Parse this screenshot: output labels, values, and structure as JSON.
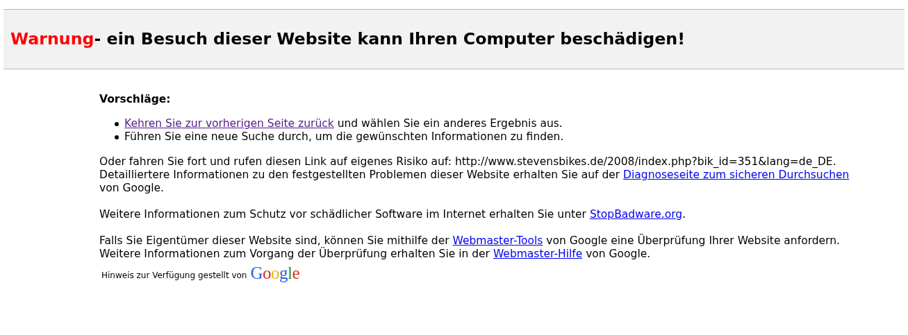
{
  "header": {
    "warning": "Warnung",
    "title": "- ein Besuch dieser Website kann Ihren Computer beschädigen!"
  },
  "suggestions": {
    "title": "Vorschläge:",
    "items": [
      [
        {
          "text": "Kehren Sie zur vorherigen Seite zurück",
          "link": true,
          "visited": true
        },
        {
          "text": " und wählen Sie ein anderes Ergebnis aus."
        }
      ],
      [
        {
          "text": "Führen Sie eine neue Suche durch, um die gewünschten Informationen zu finden."
        }
      ]
    ]
  },
  "paragraphs": [
    {
      "lines": [
        [
          {
            "text": "Oder fahren Sie fort und rufen diesen Link auf eigenes Risiko auf: http://www.stevensbikes.de/2008/index.php?bik_id=351&lang=de_DE."
          }
        ],
        [
          {
            "text": "Detailliertere Informationen zu den festgestellten Problemen dieser Website erhalten Sie auf der "
          },
          {
            "text": "Diagnoseseite zum sicheren Durchsuchen",
            "link": true,
            "visited": false
          },
          {
            "text": " von Google."
          }
        ]
      ]
    },
    {
      "lines": [
        [
          {
            "text": "Weitere Informationen zum Schutz vor schädlicher Software im Internet erhalten Sie unter "
          },
          {
            "text": "StopBadware.org",
            "link": true,
            "visited": false
          },
          {
            "text": "."
          }
        ]
      ]
    },
    {
      "lines": [
        [
          {
            "text": "Falls Sie Eigentümer dieser Website sind, können Sie mithilfe der "
          },
          {
            "text": "Webmaster-Tools",
            "link": true,
            "visited": false
          },
          {
            "text": " von Google eine Überprüfung Ihrer Website anfordern."
          }
        ],
        [
          {
            "text": "Weitere Informationen zum Vorgang der Überprüfung erhalten Sie in der "
          },
          {
            "text": "Webmaster-Hilfe",
            "link": true,
            "visited": false
          },
          {
            "text": " von Google."
          }
        ]
      ]
    }
  ],
  "footer": {
    "text": "Hinweis zur Verfügung gestellt von",
    "logo": "Google"
  }
}
